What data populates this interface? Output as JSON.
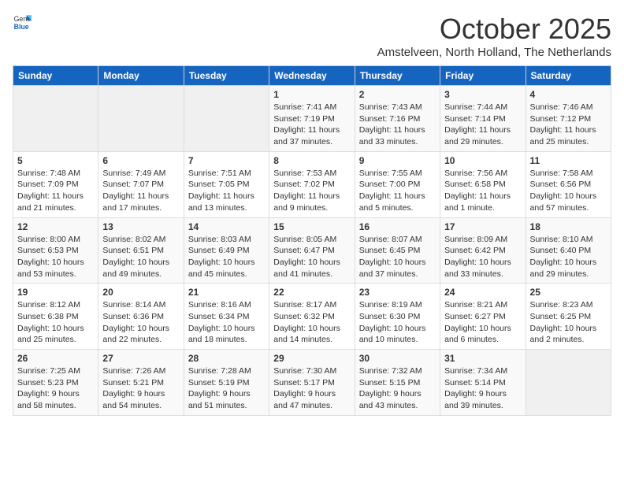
{
  "header": {
    "logo_general": "General",
    "logo_blue": "Blue",
    "month": "October 2025",
    "location": "Amstelveen, North Holland, The Netherlands"
  },
  "weekdays": [
    "Sunday",
    "Monday",
    "Tuesday",
    "Wednesday",
    "Thursday",
    "Friday",
    "Saturday"
  ],
  "weeks": [
    [
      {
        "day": "",
        "info": ""
      },
      {
        "day": "",
        "info": ""
      },
      {
        "day": "",
        "info": ""
      },
      {
        "day": "1",
        "info": "Sunrise: 7:41 AM\nSunset: 7:19 PM\nDaylight: 11 hours and 37 minutes."
      },
      {
        "day": "2",
        "info": "Sunrise: 7:43 AM\nSunset: 7:16 PM\nDaylight: 11 hours and 33 minutes."
      },
      {
        "day": "3",
        "info": "Sunrise: 7:44 AM\nSunset: 7:14 PM\nDaylight: 11 hours and 29 minutes."
      },
      {
        "day": "4",
        "info": "Sunrise: 7:46 AM\nSunset: 7:12 PM\nDaylight: 11 hours and 25 minutes."
      }
    ],
    [
      {
        "day": "5",
        "info": "Sunrise: 7:48 AM\nSunset: 7:09 PM\nDaylight: 11 hours and 21 minutes."
      },
      {
        "day": "6",
        "info": "Sunrise: 7:49 AM\nSunset: 7:07 PM\nDaylight: 11 hours and 17 minutes."
      },
      {
        "day": "7",
        "info": "Sunrise: 7:51 AM\nSunset: 7:05 PM\nDaylight: 11 hours and 13 minutes."
      },
      {
        "day": "8",
        "info": "Sunrise: 7:53 AM\nSunset: 7:02 PM\nDaylight: 11 hours and 9 minutes."
      },
      {
        "day": "9",
        "info": "Sunrise: 7:55 AM\nSunset: 7:00 PM\nDaylight: 11 hours and 5 minutes."
      },
      {
        "day": "10",
        "info": "Sunrise: 7:56 AM\nSunset: 6:58 PM\nDaylight: 11 hours and 1 minute."
      },
      {
        "day": "11",
        "info": "Sunrise: 7:58 AM\nSunset: 6:56 PM\nDaylight: 10 hours and 57 minutes."
      }
    ],
    [
      {
        "day": "12",
        "info": "Sunrise: 8:00 AM\nSunset: 6:53 PM\nDaylight: 10 hours and 53 minutes."
      },
      {
        "day": "13",
        "info": "Sunrise: 8:02 AM\nSunset: 6:51 PM\nDaylight: 10 hours and 49 minutes."
      },
      {
        "day": "14",
        "info": "Sunrise: 8:03 AM\nSunset: 6:49 PM\nDaylight: 10 hours and 45 minutes."
      },
      {
        "day": "15",
        "info": "Sunrise: 8:05 AM\nSunset: 6:47 PM\nDaylight: 10 hours and 41 minutes."
      },
      {
        "day": "16",
        "info": "Sunrise: 8:07 AM\nSunset: 6:45 PM\nDaylight: 10 hours and 37 minutes."
      },
      {
        "day": "17",
        "info": "Sunrise: 8:09 AM\nSunset: 6:42 PM\nDaylight: 10 hours and 33 minutes."
      },
      {
        "day": "18",
        "info": "Sunrise: 8:10 AM\nSunset: 6:40 PM\nDaylight: 10 hours and 29 minutes."
      }
    ],
    [
      {
        "day": "19",
        "info": "Sunrise: 8:12 AM\nSunset: 6:38 PM\nDaylight: 10 hours and 25 minutes."
      },
      {
        "day": "20",
        "info": "Sunrise: 8:14 AM\nSunset: 6:36 PM\nDaylight: 10 hours and 22 minutes."
      },
      {
        "day": "21",
        "info": "Sunrise: 8:16 AM\nSunset: 6:34 PM\nDaylight: 10 hours and 18 minutes."
      },
      {
        "day": "22",
        "info": "Sunrise: 8:17 AM\nSunset: 6:32 PM\nDaylight: 10 hours and 14 minutes."
      },
      {
        "day": "23",
        "info": "Sunrise: 8:19 AM\nSunset: 6:30 PM\nDaylight: 10 hours and 10 minutes."
      },
      {
        "day": "24",
        "info": "Sunrise: 8:21 AM\nSunset: 6:27 PM\nDaylight: 10 hours and 6 minutes."
      },
      {
        "day": "25",
        "info": "Sunrise: 8:23 AM\nSunset: 6:25 PM\nDaylight: 10 hours and 2 minutes."
      }
    ],
    [
      {
        "day": "26",
        "info": "Sunrise: 7:25 AM\nSunset: 5:23 PM\nDaylight: 9 hours and 58 minutes."
      },
      {
        "day": "27",
        "info": "Sunrise: 7:26 AM\nSunset: 5:21 PM\nDaylight: 9 hours and 54 minutes."
      },
      {
        "day": "28",
        "info": "Sunrise: 7:28 AM\nSunset: 5:19 PM\nDaylight: 9 hours and 51 minutes."
      },
      {
        "day": "29",
        "info": "Sunrise: 7:30 AM\nSunset: 5:17 PM\nDaylight: 9 hours and 47 minutes."
      },
      {
        "day": "30",
        "info": "Sunrise: 7:32 AM\nSunset: 5:15 PM\nDaylight: 9 hours and 43 minutes."
      },
      {
        "day": "31",
        "info": "Sunrise: 7:34 AM\nSunset: 5:14 PM\nDaylight: 9 hours and 39 minutes."
      },
      {
        "day": "",
        "info": ""
      }
    ]
  ]
}
